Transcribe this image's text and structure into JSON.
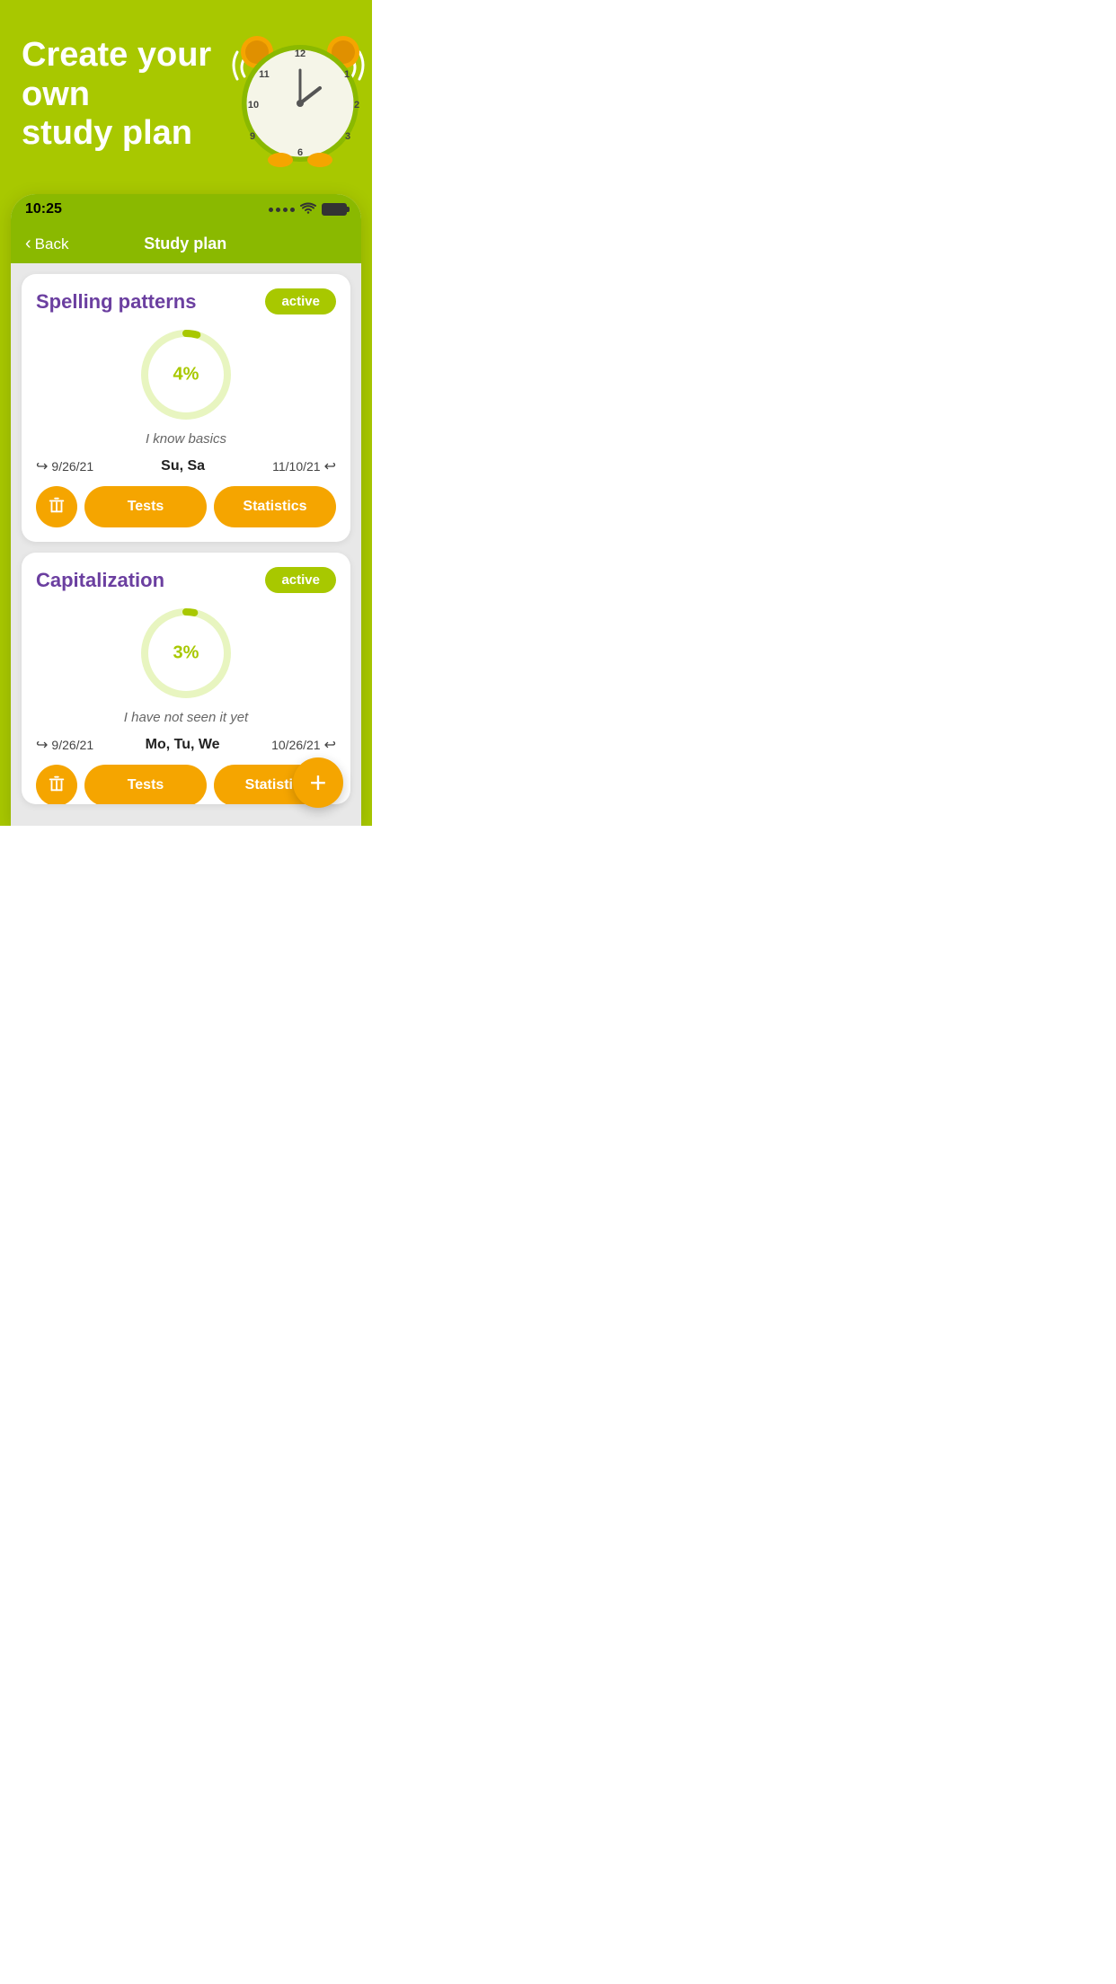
{
  "hero": {
    "title_line1": "Create your own",
    "title_line2": "study plan"
  },
  "status_bar": {
    "time": "10:25",
    "wifi": "📶",
    "colors": {
      "bg": "#8ab900",
      "battery_fill": "#333"
    }
  },
  "nav": {
    "back_label": "Back",
    "title": "Study plan"
  },
  "colors": {
    "bg": "#a8c800",
    "phone_header": "#8ab900",
    "card_title": "#6b3fa0",
    "active_badge_bg": "#a8c800",
    "progress_color": "#a8c800",
    "button_color": "#f5a500"
  },
  "card1": {
    "title": "Spelling patterns",
    "status": "active",
    "progress_percent": 4,
    "progress_label": "4%",
    "progress_circumference": 314,
    "progress_dash": 12.56,
    "subtitle": "I know basics",
    "date_start": "9/26/21",
    "days": "Su, Sa",
    "date_end": "11/10/21",
    "btn_delete_icon": "🗑",
    "btn_tests": "Tests",
    "btn_statistics": "Statistics"
  },
  "card2": {
    "title": "Capitalization",
    "status": "active",
    "progress_percent": 3,
    "progress_label": "3%",
    "progress_circumference": 314,
    "progress_dash": 9.42,
    "subtitle": "I have not seen it yet",
    "date_start": "9/26/21",
    "days": "Mo, Tu, We",
    "date_end": "10/26/21",
    "btn_delete_icon": "🗑",
    "btn_tests": "Tests",
    "btn_statistics": "Statisti..."
  },
  "fab": {
    "label": "+"
  }
}
